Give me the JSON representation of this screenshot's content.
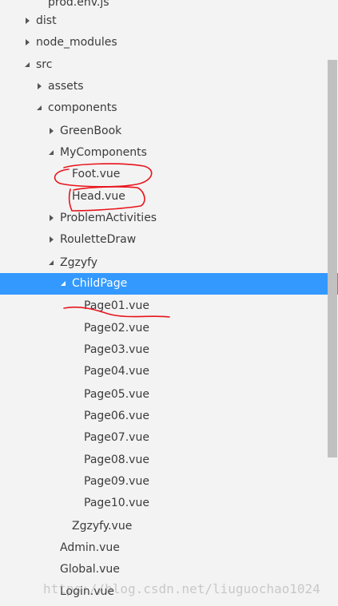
{
  "tree": {
    "rows": [
      {
        "label": "prod.env.js",
        "twisty": "none"
      },
      {
        "label": "dist",
        "twisty": "collapsed"
      },
      {
        "label": "node_modules",
        "twisty": "collapsed"
      },
      {
        "label": "src",
        "twisty": "expanded"
      },
      {
        "label": "assets",
        "twisty": "collapsed"
      },
      {
        "label": "components",
        "twisty": "expanded"
      },
      {
        "label": "GreenBook",
        "twisty": "collapsed"
      },
      {
        "label": "MyComponents",
        "twisty": "expanded"
      },
      {
        "label": "Foot.vue",
        "twisty": "none"
      },
      {
        "label": "Head.vue",
        "twisty": "none"
      },
      {
        "label": "ProblemActivities",
        "twisty": "collapsed"
      },
      {
        "label": "RouletteDraw",
        "twisty": "collapsed"
      },
      {
        "label": "Zgzyfy",
        "twisty": "expanded"
      },
      {
        "label": "ChildPage",
        "twisty": "expanded",
        "selected": true
      },
      {
        "label": "Page01.vue",
        "twisty": "none"
      },
      {
        "label": "Page02.vue",
        "twisty": "none"
      },
      {
        "label": "Page03.vue",
        "twisty": "none"
      },
      {
        "label": "Page04.vue",
        "twisty": "none"
      },
      {
        "label": "Page05.vue",
        "twisty": "none"
      },
      {
        "label": "Page06.vue",
        "twisty": "none"
      },
      {
        "label": "Page07.vue",
        "twisty": "none"
      },
      {
        "label": "Page08.vue",
        "twisty": "none"
      },
      {
        "label": "Page09.vue",
        "twisty": "none"
      },
      {
        "label": "Page10.vue",
        "twisty": "none"
      },
      {
        "label": "Zgzyfy.vue",
        "twisty": "none"
      },
      {
        "label": "Admin.vue",
        "twisty": "none"
      },
      {
        "label": "Global.vue",
        "twisty": "none"
      },
      {
        "label": "Login.vue",
        "twisty": "none"
      }
    ]
  },
  "colors": {
    "background": "#f3f3f3",
    "selection": "#3399ff",
    "annotation": "#e8141c",
    "scrollbar_thumb": "#c1c1c1"
  },
  "watermark": "https://blog.csdn.net/liuguochao1024"
}
